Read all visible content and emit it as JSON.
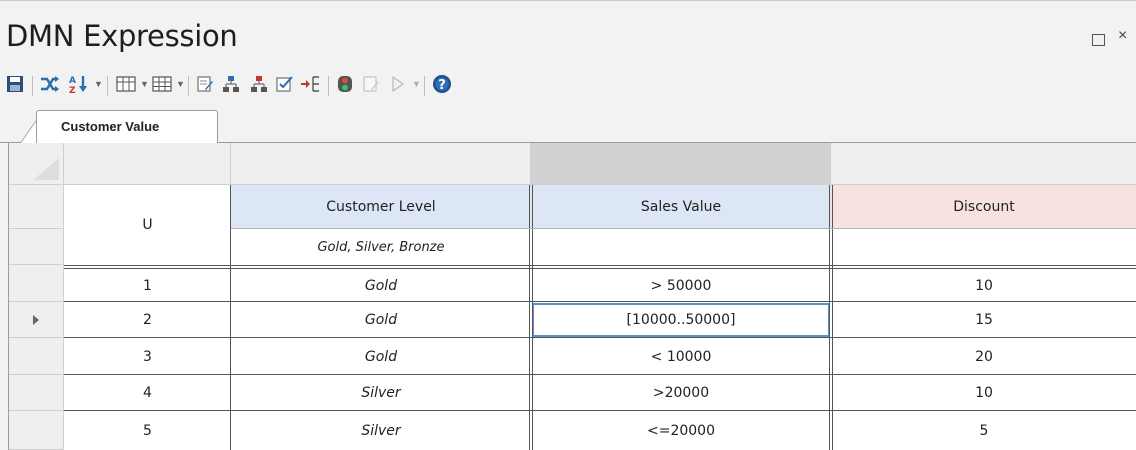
{
  "window": {
    "title": "DMN Expression"
  },
  "tabs": [
    {
      "label": "Customer Value",
      "active": true
    }
  ],
  "table": {
    "hit_policy": "U",
    "columns": [
      {
        "label": "Customer Level",
        "kind": "input",
        "allowed_values": "Gold, Silver, Bronze"
      },
      {
        "label": "Sales Value",
        "kind": "input",
        "allowed_values": ""
      },
      {
        "label": "Discount",
        "kind": "output",
        "allowed_values": ""
      }
    ],
    "rows": [
      {
        "num": "1",
        "customer_level": "Gold",
        "sales_value": "> 50000",
        "discount": "10"
      },
      {
        "num": "2",
        "customer_level": "Gold",
        "sales_value": "[10000..50000]",
        "discount": "15"
      },
      {
        "num": "3",
        "customer_level": "Gold",
        "sales_value": "< 10000",
        "discount": "20"
      },
      {
        "num": "4",
        "customer_level": "Silver",
        "sales_value": ">20000",
        "discount": "10"
      },
      {
        "num": "5",
        "customer_level": "Silver",
        "sales_value": "<=20000",
        "discount": "5"
      }
    ],
    "current_row_index": 1,
    "selected_cell": "row 2, Sales Value"
  },
  "colors": {
    "input_header": "#dce6f4",
    "output_header": "#f8e1e1",
    "selected_column_header": "#d1d1d1",
    "selection_border": "#5b8fc9"
  }
}
